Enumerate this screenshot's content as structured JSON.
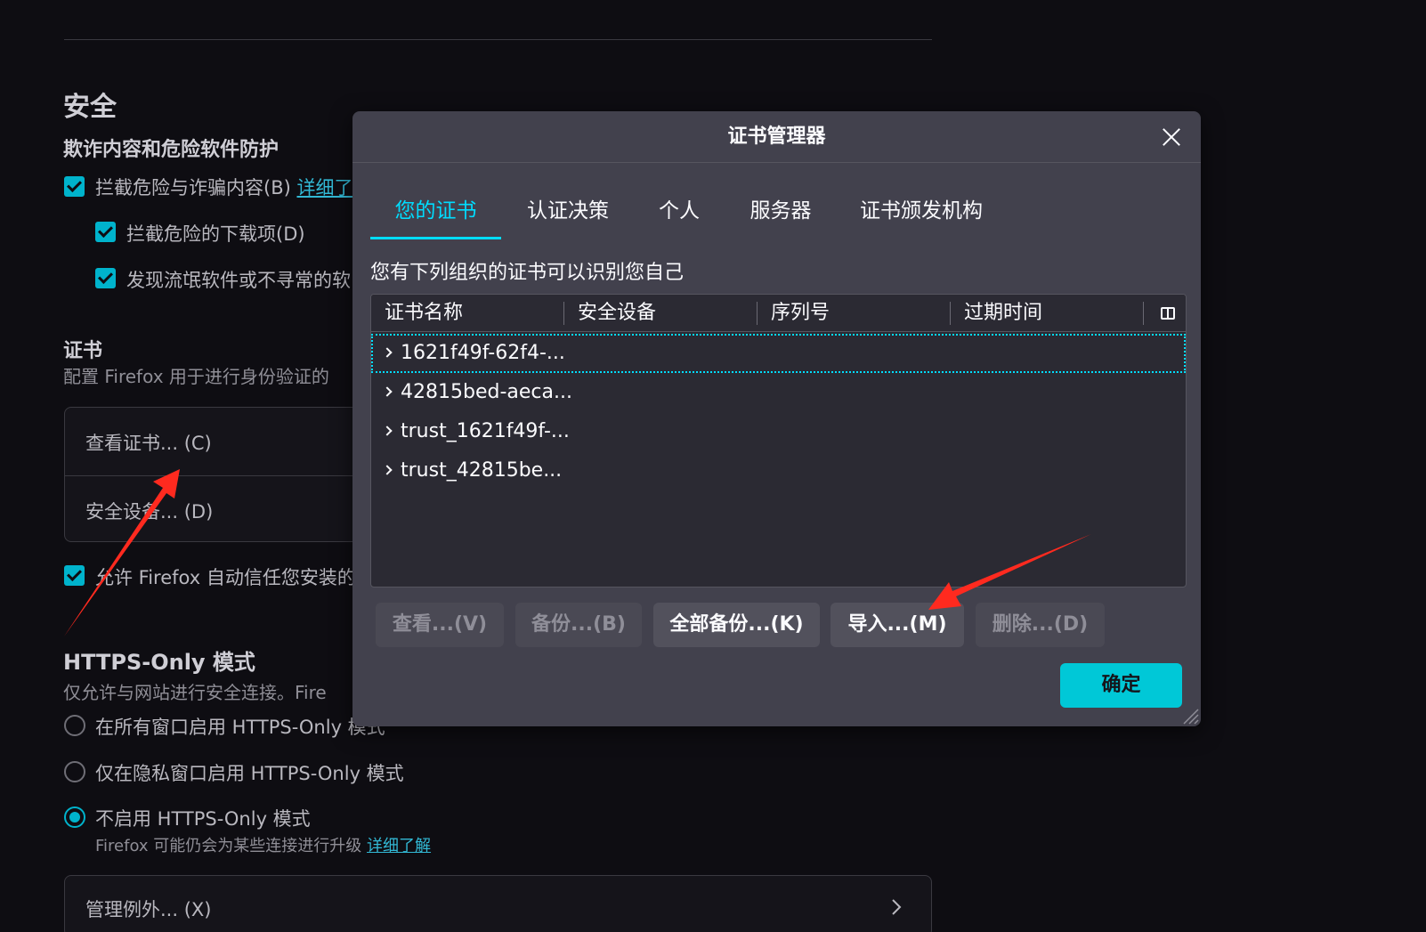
{
  "settings": {
    "security_heading": "安全",
    "fraud_heading": "欺诈内容和危险软件防护",
    "block_dangerous": "拦截危险与诈骗内容(B)",
    "learn_more_1": "详细了",
    "block_downloads": "拦截危险的下载项(D)",
    "warn_unwanted": "发现流氓软件或不寻常的软",
    "certs_heading": "证书",
    "certs_desc": "配置 Firefox 用于进行身份验证的",
    "view_certs": "查看证书... (C)",
    "security_devices": "安全设备... (D)",
    "auto_trust": "允许 Firefox 自动信任您安装的",
    "https_heading": "HTTPS-Only 模式",
    "https_desc": "仅允许与网站进行安全连接。Fire",
    "https_all": "在所有窗口启用 HTTPS-Only 模式",
    "https_private": "仅在隐私窗口启用 HTTPS-Only 模式",
    "https_off": "不启用 HTTPS-Only 模式",
    "https_off_desc": "Firefox 可能仍会为某些连接进行升级",
    "learn_more_2": "详细了解",
    "manage_exceptions": "管理例外... (X)"
  },
  "dialog": {
    "title": "证书管理器",
    "tabs": [
      {
        "label": "您的证书"
      },
      {
        "label": "认证决策"
      },
      {
        "label": "个人"
      },
      {
        "label": "服务器"
      },
      {
        "label": "证书颁发机构"
      }
    ],
    "description": "您有下列组织的证书可以识别您自己",
    "columns": [
      "证书名称",
      "安全设备",
      "序列号",
      "过期时间"
    ],
    "rows": [
      "1621f49f-62f4-...",
      "42815bed-aeca...",
      "trust_1621f49f-...",
      "trust_42815be..."
    ],
    "buttons": {
      "view": "查看...(V)",
      "backup": "备份...(B)",
      "backup_all": "全部备份...(K)",
      "import": "导入...(M)",
      "delete": "删除...(D)",
      "ok": "确定"
    }
  },
  "colors": {
    "accent": "#00ddff",
    "primary_button": "#00c8d7",
    "checkbox": "#00b3cc",
    "annotation_arrow": "#ff2a1f"
  }
}
